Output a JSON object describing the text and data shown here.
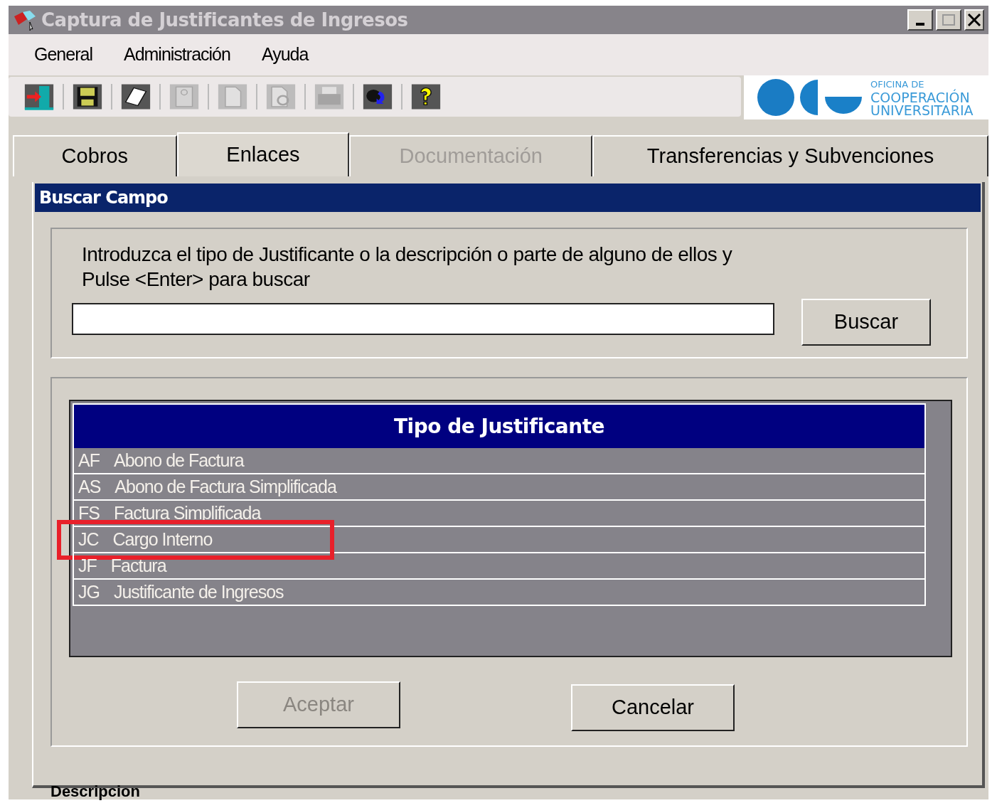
{
  "window": {
    "title": "Captura de Justificantes de Ingresos"
  },
  "menu": [
    "General",
    "Administración",
    "Ayuda"
  ],
  "toolbar": [
    {
      "kind": "exit",
      "disabled": false
    },
    {
      "kind": "save",
      "disabled": false
    },
    {
      "kind": "notes",
      "disabled": false
    },
    {
      "kind": "form",
      "disabled": true
    },
    {
      "kind": "page",
      "disabled": true
    },
    {
      "kind": "preview",
      "disabled": true
    },
    {
      "kind": "print",
      "disabled": true
    },
    {
      "kind": "swap",
      "disabled": false
    },
    {
      "kind": "help",
      "disabled": false
    }
  ],
  "logo": {
    "lines": [
      "OFICINA DE",
      "COOPERACIÓN",
      "UNIVERSITARIA"
    ]
  },
  "tabs": [
    {
      "label": "Cobros",
      "selected": false,
      "disabled": false
    },
    {
      "label": "Enlaces",
      "selected": true,
      "disabled": false
    },
    {
      "label": "Documentación",
      "selected": false,
      "disabled": true
    },
    {
      "label": "Transferencias y Subvenciones",
      "selected": false,
      "disabled": false
    }
  ],
  "dialog": {
    "title": "Buscar Campo",
    "instructions": "Introduzca el tipo de Justificante o la descripción o parte de alguno de ellos y Pulse <Enter> para buscar",
    "search_button": "Buscar",
    "list": {
      "header": "Tipo de Justificante",
      "rows": [
        {
          "code": "AF",
          "description": "Abono de Factura",
          "highlighted": false
        },
        {
          "code": "AS",
          "description": "Abono de Factura Simplificada",
          "highlighted": false
        },
        {
          "code": "FS",
          "description": "Factura Simplificada",
          "highlighted": false
        },
        {
          "code": "JC",
          "description": "Cargo Interno",
          "highlighted": true
        },
        {
          "code": "JF",
          "description": "Factura",
          "highlighted": false
        },
        {
          "code": "JG",
          "description": "Justificante de Ingresos",
          "highlighted": false
        }
      ]
    },
    "buttons": [
      {
        "label": "Aceptar",
        "disabled": true
      },
      {
        "label": "Cancelar",
        "disabled": false
      }
    ]
  },
  "background_label": "Descripcion"
}
